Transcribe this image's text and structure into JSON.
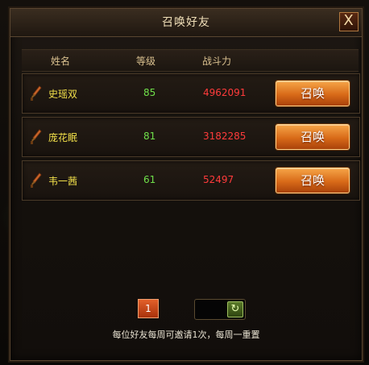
{
  "dialog": {
    "title": "召唤好友",
    "close_label": "X"
  },
  "columns": {
    "name": "姓名",
    "level": "等级",
    "power": "战斗力"
  },
  "friends": [
    {
      "name": "史瑶双",
      "level": "85",
      "power": "4962091",
      "button": "召唤"
    },
    {
      "name": "庞花眠",
      "level": "81",
      "power": "3182285",
      "button": "召唤"
    },
    {
      "name": "韦一茜",
      "level": "61",
      "power": "52497",
      "button": "召唤"
    }
  ],
  "pagination": {
    "current_page": "1"
  },
  "refresh": {
    "icon": "refresh-icon"
  },
  "footer": {
    "note": "每位好友每周可邀请1次，每周一重置"
  },
  "colors": {
    "name": "#f2e04a",
    "level": "#6fe04a",
    "power": "#ff3b3b",
    "button": "#d86a18"
  }
}
